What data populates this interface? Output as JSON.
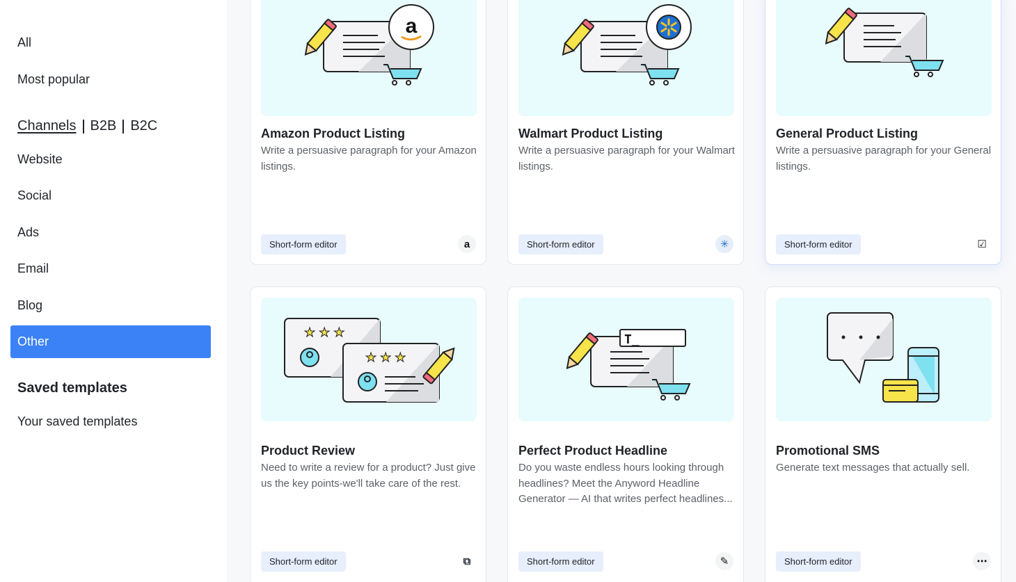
{
  "sidebar": {
    "all": "All",
    "most_popular": "Most popular",
    "channels": {
      "channels": "Channels",
      "b2b": "B2B",
      "b2c": "B2C"
    },
    "items": [
      {
        "label": "Website"
      },
      {
        "label": "Social"
      },
      {
        "label": "Ads"
      },
      {
        "label": "Email"
      },
      {
        "label": "Blog"
      },
      {
        "label": "Other"
      }
    ],
    "saved_heading": "Saved templates",
    "saved_link": "Your saved templates"
  },
  "cards": [
    {
      "title": "Amazon Product Listing",
      "desc": "Write a persuasive paragraph for your Amazon listings.",
      "badge": "Short-form editor",
      "icon": "amazon-icon",
      "icon_glyph": "a"
    },
    {
      "title": "Walmart Product Listing",
      "desc": "Write a persuasive paragraph for your Walmart listings.",
      "badge": "Short-form editor",
      "icon": "walmart-icon",
      "icon_glyph": "✳"
    },
    {
      "title": "General Product Listing",
      "desc": "Write a persuasive paragraph for your General listings.",
      "badge": "Short-form editor",
      "icon": "edit-document-icon",
      "icon_glyph": "☑"
    },
    {
      "title": "Product Review",
      "desc": "Need to write a review for a product? Just give us the key points-we'll take care of the rest.",
      "badge": "Short-form editor",
      "icon": "review-icon",
      "icon_glyph": "⧉"
    },
    {
      "title": "Perfect Product Headline",
      "desc": "Do you waste endless hours looking through headlines? Meet the Anyword Headline Generator — AI that writes perfect headlines...",
      "badge": "Short-form editor",
      "icon": "headline-icon",
      "icon_glyph": "✎"
    },
    {
      "title": "Promotional SMS",
      "desc": "Generate text messages that actually sell.",
      "badge": "Short-form editor",
      "icon": "sms-icon",
      "icon_glyph": "⋯"
    }
  ],
  "colors": {
    "accent": "#3b82f6",
    "thumb_bg": "#e8fbfd",
    "badge_bg": "#e7eefc",
    "pencil_yellow": "#f7e34a",
    "pencil_pink": "#f26b7a",
    "cart_cyan": "#7fe0f0",
    "walmart_blue": "#1d6fd1",
    "walmart_yellow": "#ffc220"
  }
}
